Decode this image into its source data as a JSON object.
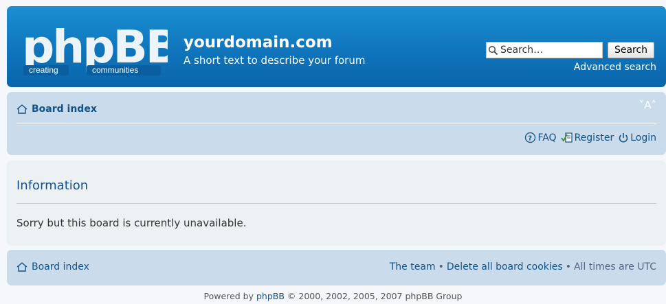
{
  "header": {
    "logo_text": "phpBB",
    "logo_tagline_left": "creating",
    "logo_tagline_right": "communities",
    "site_title": "yourdomain.com",
    "site_description": "A short text to describe your forum",
    "search_value": "Search…",
    "search_button": "Search",
    "advanced_search": "Advanced search"
  },
  "navbar": {
    "board_index": "Board index",
    "font_size_control": "˅A˄",
    "links": [
      {
        "label": "FAQ",
        "icon": "faq-icon"
      },
      {
        "label": "Register",
        "icon": "register-icon"
      },
      {
        "label": "Login",
        "icon": "login-icon"
      }
    ]
  },
  "info": {
    "title": "Information",
    "message": "Sorry but this board is currently unavailable."
  },
  "footer": {
    "board_index": "Board index",
    "the_team": "The team",
    "delete_cookies": "Delete all board cookies",
    "times": "All times are UTC",
    "separator": "•"
  },
  "copyright": {
    "prefix": "Powered by",
    "link": "phpBB",
    "suffix": "© 2000, 2002, 2005, 2007 phpBB Group"
  },
  "colors": {
    "header_blue": "#0f75bc",
    "panel_blue": "#cadceb",
    "info_bg": "#ecf1f3",
    "link": "#105289"
  }
}
